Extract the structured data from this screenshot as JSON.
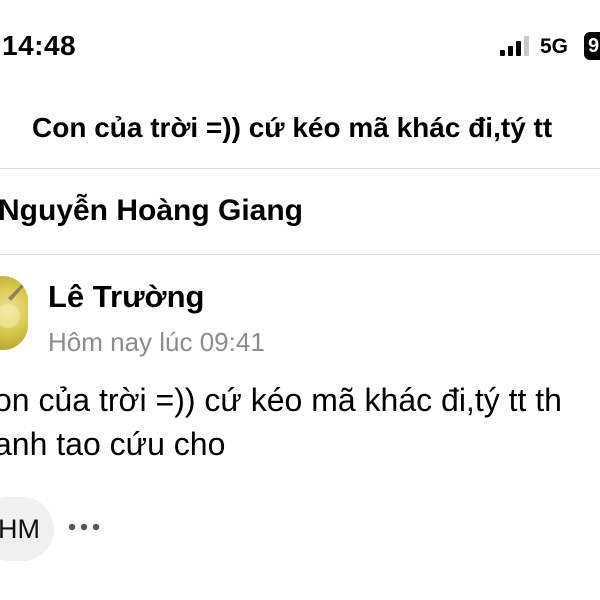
{
  "status_bar": {
    "time": "14:48",
    "network": "5G",
    "battery": "9",
    "icons": {
      "signal": "signal-strength-icon"
    }
  },
  "header": {
    "title_preview": "Con của trời =)) cứ kéo mã khác đi,tý tt"
  },
  "group": {
    "name": "Nguyễn Hoàng Giang"
  },
  "post": {
    "author": "Lê Trường",
    "timestamp": "Hôm nay lúc 09:41",
    "body_lines": [
      "on của trời =)) cứ kéo mã khác đi,tý tt th",
      "anh tao cứu cho"
    ]
  },
  "reply_bar": {
    "initials": "HM",
    "more_icon": "more-dots-icon"
  },
  "colors": {
    "text": "#000000",
    "muted": "#8c8c8c",
    "divider": "#dcdcdc",
    "chip_bg": "#f0f0f0"
  }
}
